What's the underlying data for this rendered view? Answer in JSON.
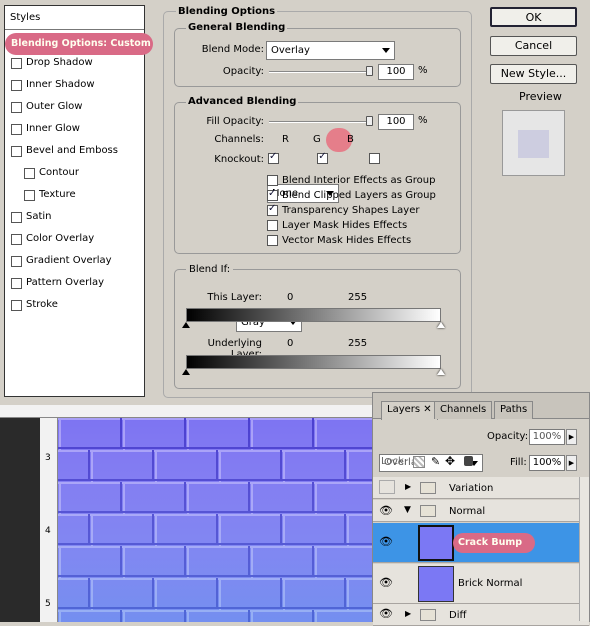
{
  "dialog": {
    "styles_title": "Styles",
    "style_items": [
      {
        "label": "Blending Options: Custom",
        "checked": false,
        "selected": true
      },
      {
        "label": "Drop Shadow",
        "checked": false
      },
      {
        "label": "Inner Shadow",
        "checked": false
      },
      {
        "label": "Outer Glow",
        "checked": false
      },
      {
        "label": "Inner Glow",
        "checked": false
      },
      {
        "label": "Bevel and Emboss",
        "checked": false
      },
      {
        "label": "Contour",
        "checked": false,
        "sub": true
      },
      {
        "label": "Texture",
        "checked": false,
        "sub": true
      },
      {
        "label": "Satin",
        "checked": false
      },
      {
        "label": "Color Overlay",
        "checked": false
      },
      {
        "label": "Gradient Overlay",
        "checked": false
      },
      {
        "label": "Pattern Overlay",
        "checked": false
      },
      {
        "label": "Stroke",
        "checked": false
      }
    ],
    "blending_options_title": "Blending Options",
    "general_blending_title": "General Blending",
    "blend_mode_label": "Blend Mode:",
    "blend_mode_value": "Overlay",
    "opacity_label": "Opacity:",
    "opacity_value": "100",
    "percent": "%",
    "advanced_blending_title": "Advanced Blending",
    "fill_opacity_label": "Fill Opacity:",
    "fill_opacity_value": "100",
    "channels_label": "Channels:",
    "channel_r": "R",
    "channel_g": "G",
    "channel_b": "B",
    "knockout_label": "Knockout:",
    "knockout_value": "None",
    "adv_options": [
      {
        "label": "Blend Interior Effects as Group",
        "checked": false
      },
      {
        "label": "Blend Clipped Layers as Group",
        "checked": true
      },
      {
        "label": "Transparency Shapes Layer",
        "checked": true
      },
      {
        "label": "Layer Mask Hides Effects",
        "checked": false
      },
      {
        "label": "Vector Mask Hides Effects",
        "checked": false
      }
    ],
    "blend_if_label": "Blend If:",
    "blend_if_value": "Gray",
    "this_layer_label": "This Layer:",
    "this_layer_min": "0",
    "this_layer_max": "255",
    "underlying_layer_label": "Underlying Layer:",
    "underlying_min": "0",
    "underlying_max": "255",
    "ok_label": "OK",
    "cancel_label": "Cancel",
    "new_style_label": "New Style...",
    "preview_label": "Preview",
    "highlight_color": "#d96a86"
  },
  "canvas": {
    "ruler_marks": [
      "3",
      "4",
      "5"
    ],
    "brick_color": "#7b73f0"
  },
  "layers": {
    "tabs": [
      {
        "label": "Layers",
        "active": true,
        "closable": true
      },
      {
        "label": "Channels",
        "active": false
      },
      {
        "label": "Paths",
        "active": false
      }
    ],
    "blend_mode": "Overlay",
    "opacity_label": "Opacity:",
    "opacity_value": "100%",
    "lock_label": "Lock:",
    "fill_label": "Fill:",
    "fill_value": "100%",
    "rows": [
      {
        "name": "Variation",
        "type": "group",
        "visible": false,
        "expanded": false
      },
      {
        "name": "Normal",
        "type": "group",
        "visible": true,
        "expanded": true
      },
      {
        "name": "Crack Bump",
        "type": "layer",
        "visible": true,
        "selected": true
      },
      {
        "name": "Brick Normal",
        "type": "layer",
        "visible": true,
        "selected": false
      },
      {
        "name": "Diff",
        "type": "group",
        "visible": true,
        "expanded": false
      }
    ]
  }
}
